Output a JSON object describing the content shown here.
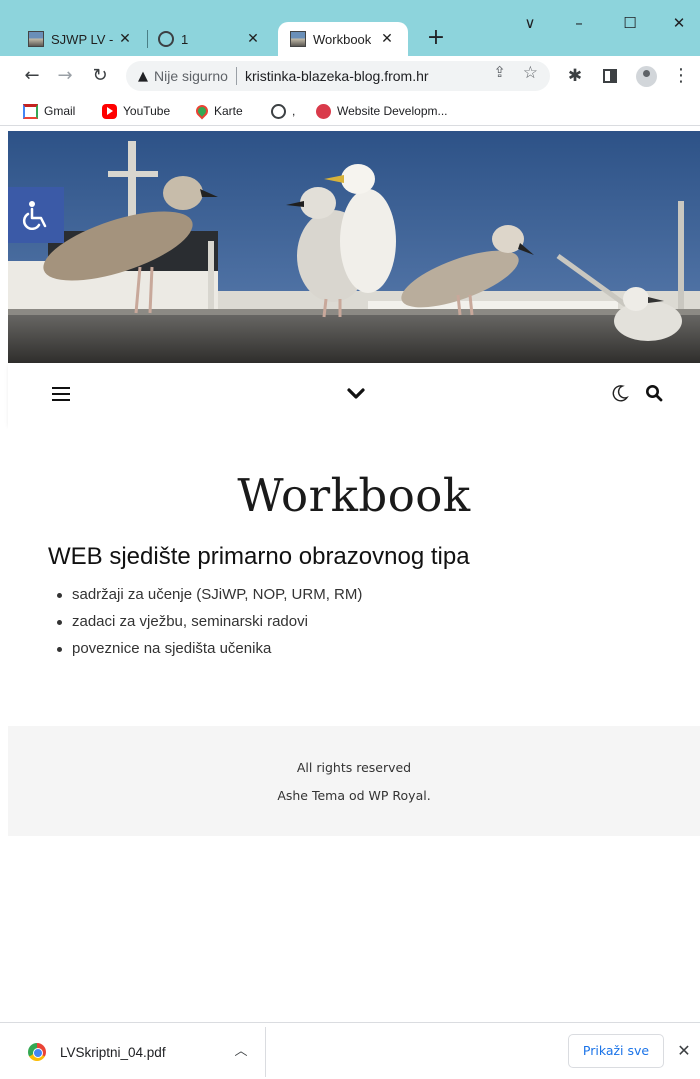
{
  "browser": {
    "tabs": [
      {
        "title": "SJWP LV -",
        "icon": "photo-favicon-icon",
        "active": false
      },
      {
        "title": "1",
        "icon": "globe-icon",
        "active": false
      },
      {
        "title": "Workbook",
        "icon": "photo-favicon-icon",
        "active": true
      }
    ],
    "window_controls": {
      "tab_search": "∨",
      "minimize": "–",
      "maximize": "☐",
      "close": "✕"
    },
    "toolbar": {
      "security_label": "Nije sigurno",
      "url": "kristinka-blazeka-blog.from.hr"
    },
    "bookmarks": [
      {
        "label": "Gmail",
        "icon": "gmail-icon"
      },
      {
        "label": "YouTube",
        "icon": "youtube-icon"
      },
      {
        "label": "Karte",
        "icon": "maps-icon"
      },
      {
        "label": ",",
        "icon": "globe-icon"
      },
      {
        "label": "Website Developm...",
        "icon": "website-dev-icon"
      }
    ]
  },
  "page": {
    "site_title": "Workbook",
    "heading": "WEB sjedište primarno obrazovnog tipa",
    "bullets": [
      "sadržaji za učenje (SJiWP, NOP, URM, RM)",
      "zadaci za vježbu, seminarski radovi",
      "poveznice na sjedišta učenika"
    ],
    "footer": {
      "line1": "All rights reserved",
      "line2": "Ashe Tema od WP Royal."
    }
  },
  "downloads": {
    "file_name": "LVSkriptni_04.pdf",
    "show_all_label": "Prikaži sve"
  },
  "colors": {
    "tabstrip": "#8dd4dc",
    "accessibility_button": "#3b5aa7",
    "footer_bg": "#f5f5f5",
    "link_blue": "#1a73e8"
  }
}
